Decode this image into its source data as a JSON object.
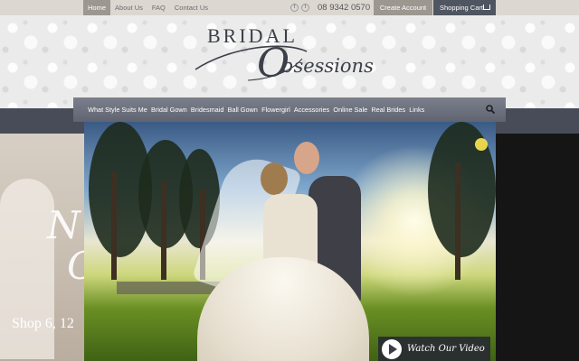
{
  "topbar": {
    "nav": [
      "Home",
      "About Us",
      "FAQ",
      "Contact Us"
    ],
    "social": [
      "f",
      "t"
    ],
    "phone": "08 9342 0570",
    "create_account": "Create Account",
    "shopping_cart": "Shopping Cart"
  },
  "logo": {
    "bridal": "BRIDAL",
    "o": "O",
    "rest": "bsessions"
  },
  "mainnav": {
    "items": [
      "What Style Suits Me",
      "Bridal Gown",
      "Bridesmaid",
      "Ball Gown",
      "Flowergirl",
      "Accessories",
      "Online Sale",
      "Real Brides",
      "Links"
    ]
  },
  "side": {
    "script_1": "N",
    "script_2": "C",
    "shop": "Shop 6, 12"
  },
  "hero": {
    "watch_video": "Watch Our Video"
  }
}
